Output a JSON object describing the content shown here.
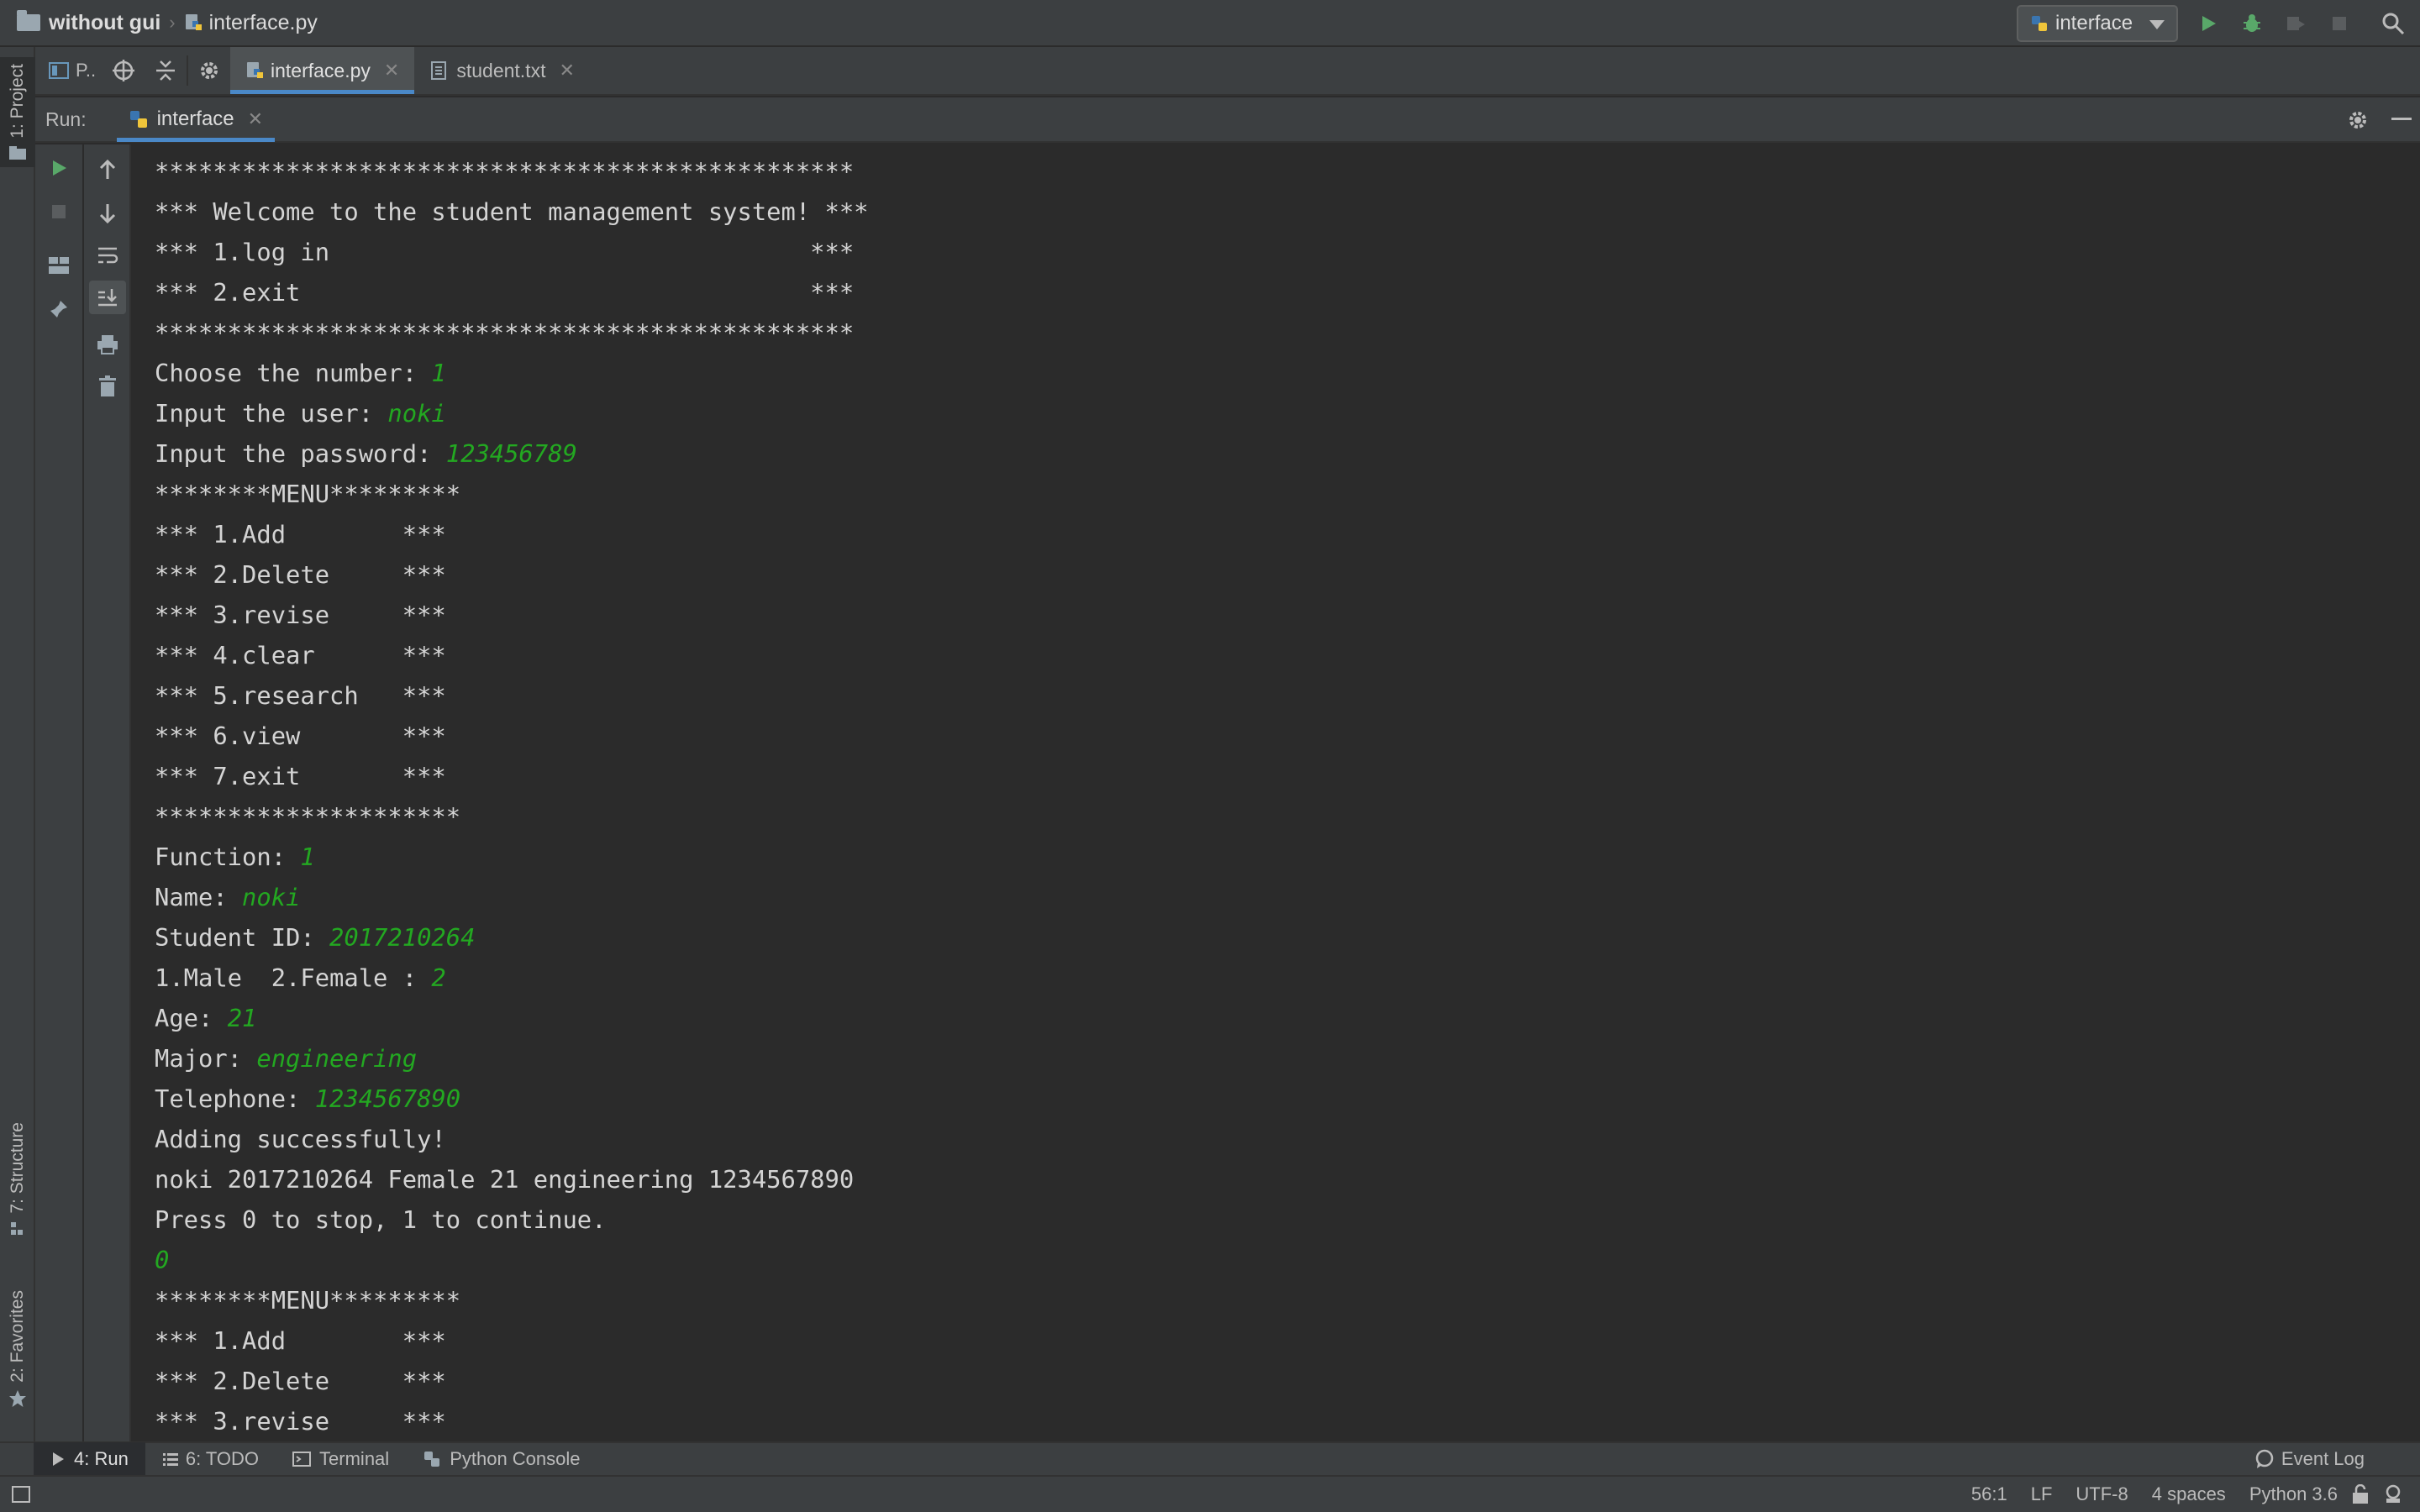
{
  "navbar": {
    "project_folder": "without gui",
    "file": "interface.py",
    "run_config": "interface"
  },
  "left_stripe": {
    "project_tab": "1: Project",
    "structure_tab": "7: Structure",
    "favorites_tab": "2: Favorites"
  },
  "toolbar": {
    "project_view": "P.."
  },
  "editor_tabs": [
    "interface.py",
    "student.txt"
  ],
  "run_panel": {
    "label": "Run:",
    "tab": "interface"
  },
  "console": {
    "lines": [
      {
        "text": "************************************************",
        "input": ""
      },
      {
        "text": "*** Welcome to the student management system! ***",
        "input": ""
      },
      {
        "text": "*** 1.log in                                 ***",
        "input": ""
      },
      {
        "text": "*** 2.exit                                   ***",
        "input": ""
      },
      {
        "text": "************************************************",
        "input": ""
      },
      {
        "text": "Choose the number: ",
        "input": "1"
      },
      {
        "text": "Input the user: ",
        "input": "noki"
      },
      {
        "text": "Input the password: ",
        "input": "123456789"
      },
      {
        "text": "********MENU*********",
        "input": ""
      },
      {
        "text": "*** 1.Add        ***",
        "input": ""
      },
      {
        "text": "*** 2.Delete     ***",
        "input": ""
      },
      {
        "text": "*** 3.revise     ***",
        "input": ""
      },
      {
        "text": "*** 4.clear      ***",
        "input": ""
      },
      {
        "text": "*** 5.research   ***",
        "input": ""
      },
      {
        "text": "*** 6.view       ***",
        "input": ""
      },
      {
        "text": "*** 7.exit       ***",
        "input": ""
      },
      {
        "text": "*********************",
        "input": ""
      },
      {
        "text": "Function: ",
        "input": "1"
      },
      {
        "text": "Name: ",
        "input": "noki"
      },
      {
        "text": "Student ID: ",
        "input": "2017210264"
      },
      {
        "text": "1.Male  2.Female : ",
        "input": "2"
      },
      {
        "text": "Age: ",
        "input": "21"
      },
      {
        "text": "Major: ",
        "input": "engineering"
      },
      {
        "text": "Telephone: ",
        "input": "1234567890"
      },
      {
        "text": "Adding successfully!",
        "input": ""
      },
      {
        "text": "noki 2017210264 Female 21 engineering 1234567890",
        "input": ""
      },
      {
        "text": "Press 0 to stop, 1 to continue.",
        "input": ""
      },
      {
        "text": "",
        "input": "0"
      },
      {
        "text": "********MENU*********",
        "input": ""
      },
      {
        "text": "*** 1.Add        ***",
        "input": ""
      },
      {
        "text": "*** 2.Delete     ***",
        "input": ""
      },
      {
        "text": "*** 3.revise     ***",
        "input": ""
      }
    ]
  },
  "bottom_tabs": {
    "run": "4: Run",
    "todo": "6: TODO",
    "terminal": "Terminal",
    "python_console": "Python Console",
    "event_log": "Event Log"
  },
  "status_bar": {
    "position": "56:1",
    "line_sep": "LF",
    "encoding": "UTF-8",
    "indent": "4 spaces",
    "interpreter": "Python 3.6"
  },
  "colors": {
    "input_text": "#23a821",
    "accent": "#4a88c7",
    "run_green": "#59a869"
  }
}
